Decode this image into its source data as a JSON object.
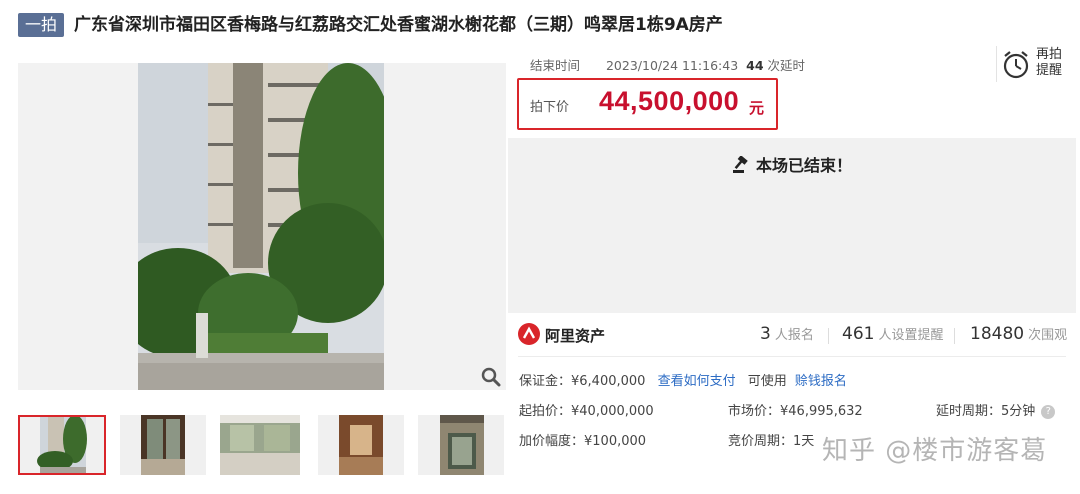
{
  "header": {
    "badge": "一拍",
    "title": "广东省深圳市福田区香梅路与红荔路交汇处香蜜湖水榭花都（三期）鸣翠居1栋9A房产"
  },
  "auction": {
    "end_label": "结束时间",
    "end_time": "2023/10/24 11:16:43",
    "extend_count": "44",
    "extend_suffix": "次延时",
    "remind_line1": "再拍",
    "remind_line2": "提醒",
    "price_label": "拍下价",
    "price_value": "44,500,000",
    "price_unit": "元",
    "ended_text": "本场已结束！"
  },
  "platform": {
    "name": "阿里资产",
    "signups": "3",
    "signups_label": "人报名",
    "reminders": "461",
    "reminders_label": "人设置提醒",
    "views": "18480",
    "views_label": "次围观"
  },
  "details": {
    "deposit": "保证金：¥6,400,000",
    "how_to_pay": "查看如何支付",
    "usable": "可使用",
    "credit_signup": "赊钱报名",
    "start_price": "起拍价：¥40,000,000",
    "market_price": "市场价：¥46,995,632",
    "delay_period": "延时周期：5分钟",
    "increment": "加价幅度：¥100,000",
    "bid_period": "竞价周期：1天"
  },
  "watermark": "知乎 @楼市游客葛",
  "colors": {
    "accent_red": "#d9252a",
    "price_red": "#c8102e",
    "badge_bg": "#5a6f95",
    "link_blue": "#2d6cc4"
  },
  "icons": {
    "zoom": "magnifier-icon",
    "remind": "alarm-clock-icon",
    "ended": "gavel-icon",
    "platform": "ali-asset-logo"
  }
}
